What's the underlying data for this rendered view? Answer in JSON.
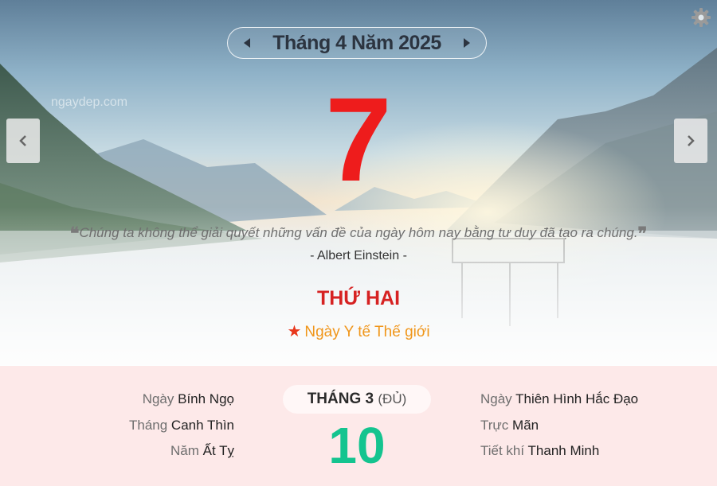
{
  "header": {
    "month_title": "Tháng 4 Năm 2025",
    "prev_month_icon": "caret-left-icon",
    "next_month_icon": "caret-right-icon",
    "settings_icon": "gear-icon"
  },
  "watermark": "ngaydep.com",
  "nav": {
    "prev_day_icon": "chevron-left-icon",
    "next_day_icon": "chevron-right-icon"
  },
  "day": {
    "number": "7",
    "color": "#ee1c1c"
  },
  "quote": {
    "open_mark": "❝",
    "text": "Chúng ta không thể giải quyết những vấn đề của ngày hôm nay bằng tư duy đã tạo ra chúng.",
    "close_mark": "❞",
    "author": "- Albert Einstein -"
  },
  "weekday": {
    "label": "THỨ HAI",
    "color": "#d62222"
  },
  "holiday": {
    "icon": "star-icon",
    "label": "Ngày Y tế Thế giới",
    "color": "#f0961a"
  },
  "lunar": {
    "left": [
      {
        "key": "Ngày",
        "value": "Bính Ngọ"
      },
      {
        "key": "Tháng",
        "value": "Canh Thìn"
      },
      {
        "key": "Năm",
        "value": "Ất Tỵ"
      }
    ],
    "month_label": "THÁNG 3",
    "month_sub": "(ĐỦ)",
    "day": "10",
    "day_color": "#14c48f",
    "right": [
      {
        "key": "Ngày",
        "value": "Thiên Hình Hắc Đạo"
      },
      {
        "key": "Trực",
        "value": "Mãn"
      },
      {
        "key": "Tiết khí",
        "value": "Thanh Minh"
      }
    ]
  }
}
